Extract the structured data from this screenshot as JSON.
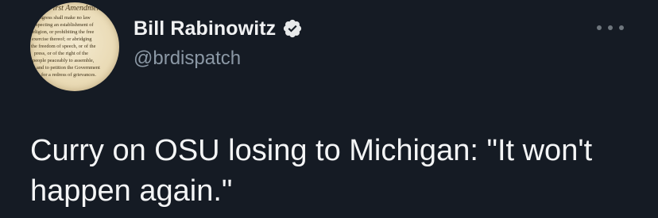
{
  "tweet": {
    "author": {
      "display_name": "Bill Rabinowitz",
      "handle": "@brdispatch",
      "verified": true,
      "avatar_text": {
        "title": "First Amendment",
        "lines": [
          "Congress shall make no law",
          "respecting an establishment of",
          "religion, or prohibiting the free",
          "exercise thereof; or abridging",
          "the freedom of speech, or of the",
          "press, or of the right of the",
          "people peaceably to assemble,",
          "and to petition the Government",
          "for a redress of grievances."
        ]
      }
    },
    "text": "Curry on OSU losing to Michigan: \"It won't happen again.\"",
    "more_icon": "ellipsis-icon"
  },
  "colors": {
    "background": "#151b24",
    "primary_text": "#e7e9ea",
    "secondary_text": "#8b98a5",
    "verified_badge": "#e7e9ea"
  }
}
